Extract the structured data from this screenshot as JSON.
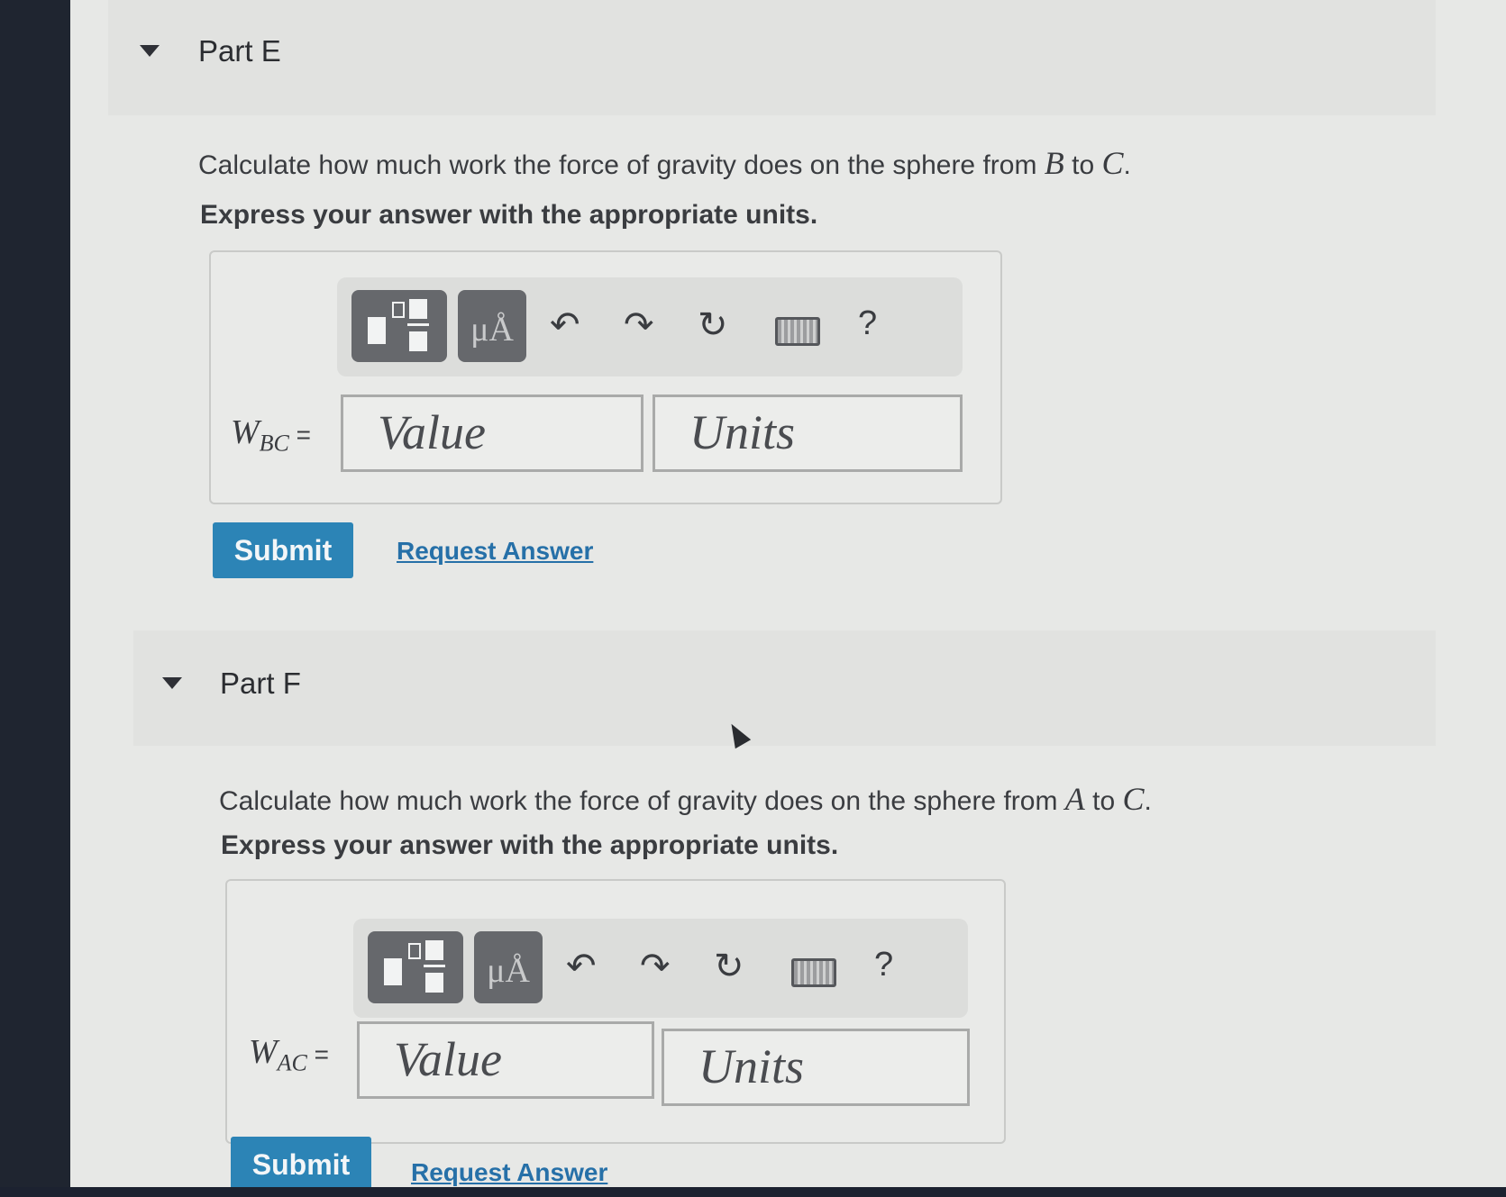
{
  "parts": [
    {
      "title": "Part E",
      "question_pre": "Calculate how much work the force of gravity does on the sphere from ",
      "from": "B",
      "to_word": " to ",
      "to": "C",
      "period": ".",
      "instruction": "Express your answer with the appropriate units.",
      "var_letter": "W",
      "var_sub": "BC",
      "equals": " =",
      "value_placeholder": "Value",
      "units_placeholder": "Units",
      "submit_label": "Submit",
      "request_label": "Request Answer"
    },
    {
      "title": "Part F",
      "question_pre": "Calculate how much work the force of gravity does on the sphere from ",
      "from": "A",
      "to_word": " to ",
      "to": "C",
      "period": ".",
      "instruction": "Express your answer with the appropriate units.",
      "var_letter": "W",
      "var_sub": "AC",
      "equals": " =",
      "value_placeholder": "Value",
      "units_placeholder": "Units",
      "submit_label": "Submit",
      "request_label": "Request Answer"
    }
  ],
  "toolbar": {
    "templates_icon": "fraction-template-icon",
    "units_symbol": "μÅ",
    "undo_icon": "undo-icon",
    "redo_icon": "redo-icon",
    "reset_icon": "reset-icon",
    "keyboard_icon": "keyboard-icon",
    "help_label": "?"
  },
  "colors": {
    "submit_bg": "#2c84b6",
    "link": "#2670a8",
    "toolbar_button": "#66686c"
  }
}
